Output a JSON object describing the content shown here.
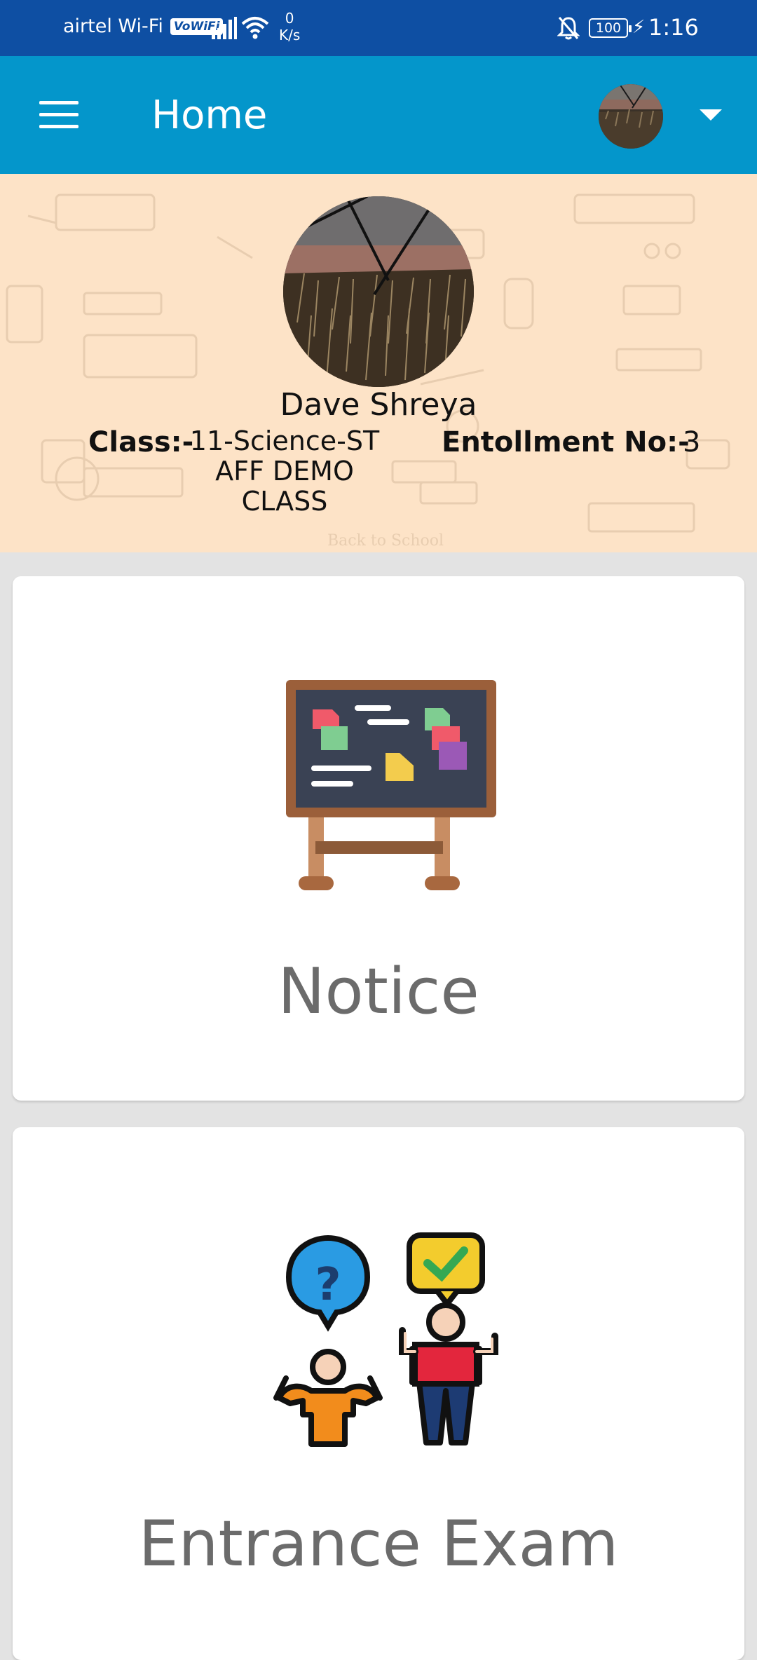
{
  "status_bar": {
    "carrier": "airtel Wi-Fi",
    "vowifi_badge": "VoWiFi",
    "speed_value": "0",
    "speed_unit": "K/s",
    "battery": "100",
    "time": "1:16",
    "icons": [
      "signal-icon",
      "wifi-icon",
      "bell-off-icon",
      "battery-icon",
      "charge-icon"
    ]
  },
  "app_bar": {
    "title": "Home",
    "menu_icon": "hamburger-menu-icon",
    "dropdown_icon": "caret-down-icon"
  },
  "profile": {
    "name": "Dave Shreya",
    "class_label": "Class:-",
    "class_value": "11-Science-ST AFF DEMO CLASS",
    "enrollment_label": "Entollment No:-",
    "enrollment_value": "3",
    "banner_caption": "Back to School"
  },
  "menu_cards": [
    {
      "label": "Notice",
      "icon": "notice-board-icon"
    },
    {
      "label": "Entrance Exam",
      "icon": "entrance-exam-icon"
    }
  ],
  "colors": {
    "status_bar": "#0e4fa3",
    "app_bar": "#0496cb",
    "banner": "#fde3c7",
    "background": "#e3e3e3",
    "card_text": "#6b6b6b"
  }
}
